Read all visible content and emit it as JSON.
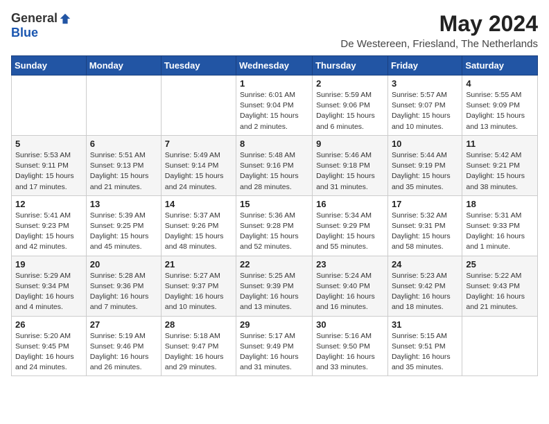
{
  "logo": {
    "general": "General",
    "blue": "Blue"
  },
  "title": {
    "month_year": "May 2024",
    "location": "De Westereen, Friesland, The Netherlands"
  },
  "weekdays": [
    "Sunday",
    "Monday",
    "Tuesday",
    "Wednesday",
    "Thursday",
    "Friday",
    "Saturday"
  ],
  "weeks": [
    [
      {
        "day": "",
        "info": ""
      },
      {
        "day": "",
        "info": ""
      },
      {
        "day": "",
        "info": ""
      },
      {
        "day": "1",
        "info": "Sunrise: 6:01 AM\nSunset: 9:04 PM\nDaylight: 15 hours\nand 2 minutes."
      },
      {
        "day": "2",
        "info": "Sunrise: 5:59 AM\nSunset: 9:06 PM\nDaylight: 15 hours\nand 6 minutes."
      },
      {
        "day": "3",
        "info": "Sunrise: 5:57 AM\nSunset: 9:07 PM\nDaylight: 15 hours\nand 10 minutes."
      },
      {
        "day": "4",
        "info": "Sunrise: 5:55 AM\nSunset: 9:09 PM\nDaylight: 15 hours\nand 13 minutes."
      }
    ],
    [
      {
        "day": "5",
        "info": "Sunrise: 5:53 AM\nSunset: 9:11 PM\nDaylight: 15 hours\nand 17 minutes."
      },
      {
        "day": "6",
        "info": "Sunrise: 5:51 AM\nSunset: 9:13 PM\nDaylight: 15 hours\nand 21 minutes."
      },
      {
        "day": "7",
        "info": "Sunrise: 5:49 AM\nSunset: 9:14 PM\nDaylight: 15 hours\nand 24 minutes."
      },
      {
        "day": "8",
        "info": "Sunrise: 5:48 AM\nSunset: 9:16 PM\nDaylight: 15 hours\nand 28 minutes."
      },
      {
        "day": "9",
        "info": "Sunrise: 5:46 AM\nSunset: 9:18 PM\nDaylight: 15 hours\nand 31 minutes."
      },
      {
        "day": "10",
        "info": "Sunrise: 5:44 AM\nSunset: 9:19 PM\nDaylight: 15 hours\nand 35 minutes."
      },
      {
        "day": "11",
        "info": "Sunrise: 5:42 AM\nSunset: 9:21 PM\nDaylight: 15 hours\nand 38 minutes."
      }
    ],
    [
      {
        "day": "12",
        "info": "Sunrise: 5:41 AM\nSunset: 9:23 PM\nDaylight: 15 hours\nand 42 minutes."
      },
      {
        "day": "13",
        "info": "Sunrise: 5:39 AM\nSunset: 9:25 PM\nDaylight: 15 hours\nand 45 minutes."
      },
      {
        "day": "14",
        "info": "Sunrise: 5:37 AM\nSunset: 9:26 PM\nDaylight: 15 hours\nand 48 minutes."
      },
      {
        "day": "15",
        "info": "Sunrise: 5:36 AM\nSunset: 9:28 PM\nDaylight: 15 hours\nand 52 minutes."
      },
      {
        "day": "16",
        "info": "Sunrise: 5:34 AM\nSunset: 9:29 PM\nDaylight: 15 hours\nand 55 minutes."
      },
      {
        "day": "17",
        "info": "Sunrise: 5:32 AM\nSunset: 9:31 PM\nDaylight: 15 hours\nand 58 minutes."
      },
      {
        "day": "18",
        "info": "Sunrise: 5:31 AM\nSunset: 9:33 PM\nDaylight: 16 hours\nand 1 minute."
      }
    ],
    [
      {
        "day": "19",
        "info": "Sunrise: 5:29 AM\nSunset: 9:34 PM\nDaylight: 16 hours\nand 4 minutes."
      },
      {
        "day": "20",
        "info": "Sunrise: 5:28 AM\nSunset: 9:36 PM\nDaylight: 16 hours\nand 7 minutes."
      },
      {
        "day": "21",
        "info": "Sunrise: 5:27 AM\nSunset: 9:37 PM\nDaylight: 16 hours\nand 10 minutes."
      },
      {
        "day": "22",
        "info": "Sunrise: 5:25 AM\nSunset: 9:39 PM\nDaylight: 16 hours\nand 13 minutes."
      },
      {
        "day": "23",
        "info": "Sunrise: 5:24 AM\nSunset: 9:40 PM\nDaylight: 16 hours\nand 16 minutes."
      },
      {
        "day": "24",
        "info": "Sunrise: 5:23 AM\nSunset: 9:42 PM\nDaylight: 16 hours\nand 18 minutes."
      },
      {
        "day": "25",
        "info": "Sunrise: 5:22 AM\nSunset: 9:43 PM\nDaylight: 16 hours\nand 21 minutes."
      }
    ],
    [
      {
        "day": "26",
        "info": "Sunrise: 5:20 AM\nSunset: 9:45 PM\nDaylight: 16 hours\nand 24 minutes."
      },
      {
        "day": "27",
        "info": "Sunrise: 5:19 AM\nSunset: 9:46 PM\nDaylight: 16 hours\nand 26 minutes."
      },
      {
        "day": "28",
        "info": "Sunrise: 5:18 AM\nSunset: 9:47 PM\nDaylight: 16 hours\nand 29 minutes."
      },
      {
        "day": "29",
        "info": "Sunrise: 5:17 AM\nSunset: 9:49 PM\nDaylight: 16 hours\nand 31 minutes."
      },
      {
        "day": "30",
        "info": "Sunrise: 5:16 AM\nSunset: 9:50 PM\nDaylight: 16 hours\nand 33 minutes."
      },
      {
        "day": "31",
        "info": "Sunrise: 5:15 AM\nSunset: 9:51 PM\nDaylight: 16 hours\nand 35 minutes."
      },
      {
        "day": "",
        "info": ""
      }
    ]
  ]
}
